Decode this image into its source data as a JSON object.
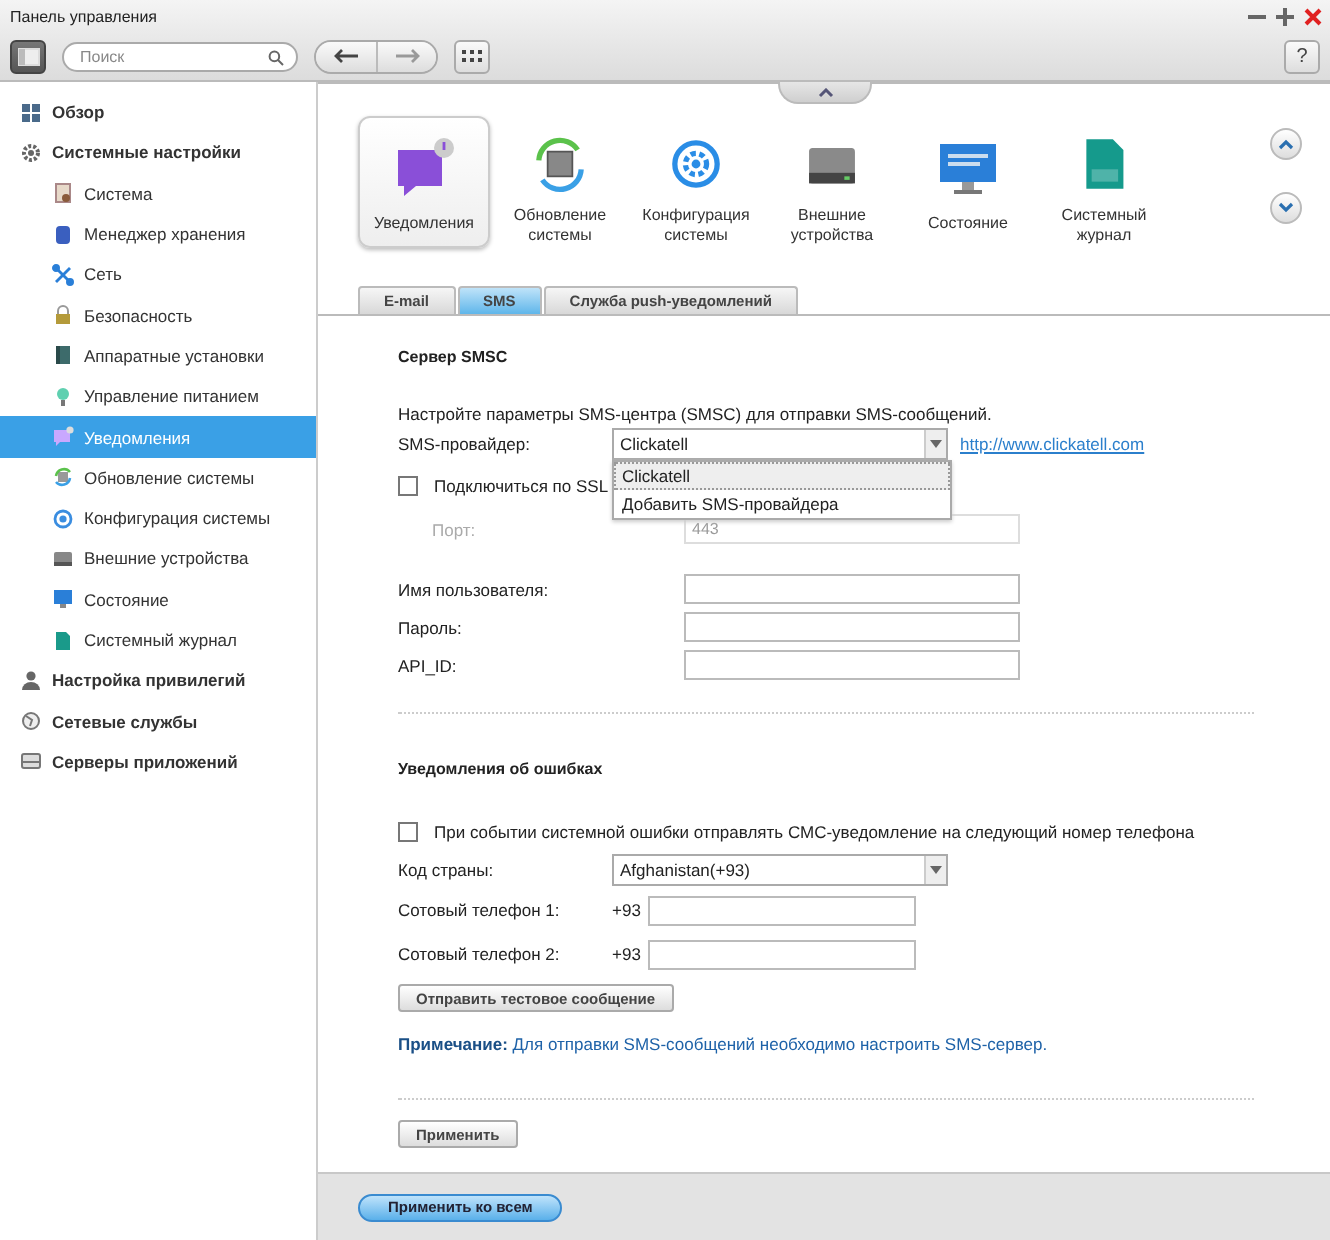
{
  "window": {
    "title": "Панель управления",
    "help": "?"
  },
  "toolbar": {
    "search": {
      "placeholder": "Поиск"
    }
  },
  "sidebar": {
    "items": [
      {
        "label": "Обзор",
        "selected": false
      },
      {
        "label": "Системные настройки",
        "selected": false,
        "children": [
          {
            "label": "Система",
            "selected": false
          },
          {
            "label": "Менеджер хранения",
            "selected": false
          },
          {
            "label": "Сеть",
            "selected": false
          },
          {
            "label": "Безопасность",
            "selected": false
          },
          {
            "label": "Аппаратные установки",
            "selected": false
          },
          {
            "label": "Управление питанием",
            "selected": false
          },
          {
            "label": "Уведомления",
            "selected": true
          },
          {
            "label": "Обновление системы",
            "selected": false
          },
          {
            "label": "Конфигурация системы",
            "selected": false
          },
          {
            "label": "Внешние устройства",
            "selected": false
          },
          {
            "label": "Состояние",
            "selected": false
          },
          {
            "label": "Системный журнал",
            "selected": false
          }
        ]
      },
      {
        "label": "Настройка привилегий",
        "selected": false
      },
      {
        "label": "Сетевые службы",
        "selected": false
      },
      {
        "label": "Серверы приложений",
        "selected": false
      }
    ]
  },
  "app_strip": {
    "items": [
      {
        "label": "Уведомления",
        "selected": true
      },
      {
        "label": "Обновление системы",
        "selected": false
      },
      {
        "label": "Конфигурация системы",
        "selected": false
      },
      {
        "label": "Внешние устройства",
        "selected": false
      },
      {
        "label": "Состояние",
        "selected": false
      },
      {
        "label": "Системный журнал",
        "selected": false
      }
    ]
  },
  "tabs": [
    {
      "label": "E-mail",
      "selected": false
    },
    {
      "label": "SMS",
      "selected": true
    },
    {
      "label": "Служба push-уведомлений",
      "selected": false
    }
  ],
  "smsc": {
    "title": "Сервер SMSC",
    "description": "Настройте параметры SMS-центра (SMSC) для отправки SMS-сообщений.",
    "provider": {
      "label": "SMS-провайдер:",
      "value": "Clickatell",
      "link": "http://www.clickatell.com",
      "options": [
        {
          "label": "Clickatell",
          "selected": true
        },
        {
          "label": "Добавить SMS-провайдера",
          "selected": false
        }
      ]
    },
    "ssl": {
      "label": "Подключиться по SSL",
      "checked": false
    },
    "port": {
      "label": "Порт:",
      "value": "443",
      "disabled": true
    },
    "fields": [
      {
        "label": "Имя пользователя:"
      },
      {
        "label": "Пароль:"
      },
      {
        "label": "API_ID:"
      }
    ]
  },
  "errors": {
    "title": "Уведомления об ошибках",
    "notify": {
      "label": "При событии системной ошибки отправлять СМС-уведомление на следующий номер телефона",
      "checked": false
    },
    "country": {
      "label": "Код страны:",
      "value": "Afghanistan(+93)"
    },
    "phones": [
      {
        "label": "Сотовый телефон 1:",
        "prefix": "+93"
      },
      {
        "label": "Сотовый телефон 2:",
        "prefix": "+93"
      }
    ],
    "test_button": "Отправить тестовое сообщение",
    "note": "**Примечание:** Для отправки SMS-сообщений необходимо настроить SMS-сервер."
  },
  "apply_button": "Применить",
  "footer": {
    "apply_all_button": "Применить ко всем"
  }
}
